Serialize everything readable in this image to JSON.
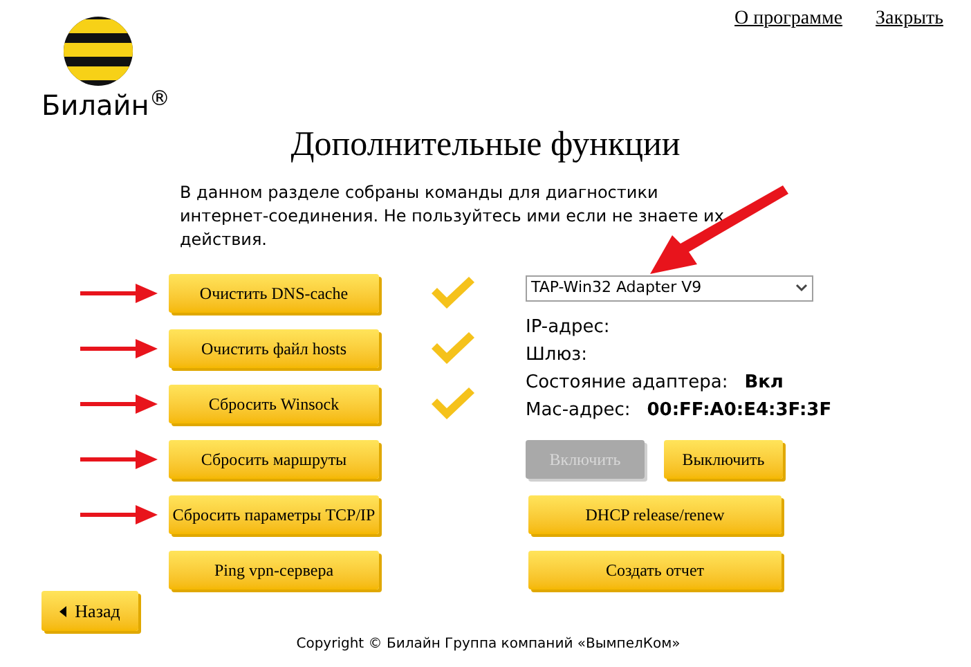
{
  "header": {
    "links": [
      "О программе",
      "Закрыть"
    ]
  },
  "logo": {
    "text": "Билайн$^{®}$"
  },
  "title": "Дополнительные функции",
  "description": "В данном разделе собраны команды для диагностики интернет-соединения. Не пользуйтесь ими если не знаете их действия.",
  "annotation_arrow": true,
  "actions": [
    {
      "label": "Очистить DNS-cache",
      "done": true,
      "arrow": true
    },
    {
      "label": "Очистить файл hosts",
      "done": true,
      "arrow": true
    },
    {
      "label": "Сбросить Winsock",
      "done": true,
      "arrow": true
    },
    {
      "label": "Сбросить маршруты",
      "done": false,
      "arrow": true
    },
    {
      "label": "Сбросить параметры TCP/IP",
      "done": false,
      "arrow": true
    },
    {
      "label": "Ping vpn-сервера",
      "done": false,
      "arrow": false
    }
  ],
  "adapter": {
    "value": "TAP-Win32 Adapter V9",
    "fields": [
      {
        "label": "IP-адрес:"
      },
      {
        "label": "Шлюз:"
      },
      {
        "label": "Состояние адаптера:",
        "value": "Вкл"
      },
      {
        "label": "Мас-адрес:",
        "value": "00:FF:A0:E4:3F:3F"
      }
    ],
    "buttons": [
      {
        "label": "Включить",
        "disabled": true
      },
      {
        "label": "Выключить",
        "disabled": false
      },
      {
        "label": "DHCP release/renew",
        "disabled": false
      },
      {
        "label": "Создать отчет",
        "disabled": false
      }
    ]
  },
  "back": "Назад",
  "footer": "Copyright © Билайн Группа компаний «ВымпелКом»"
}
